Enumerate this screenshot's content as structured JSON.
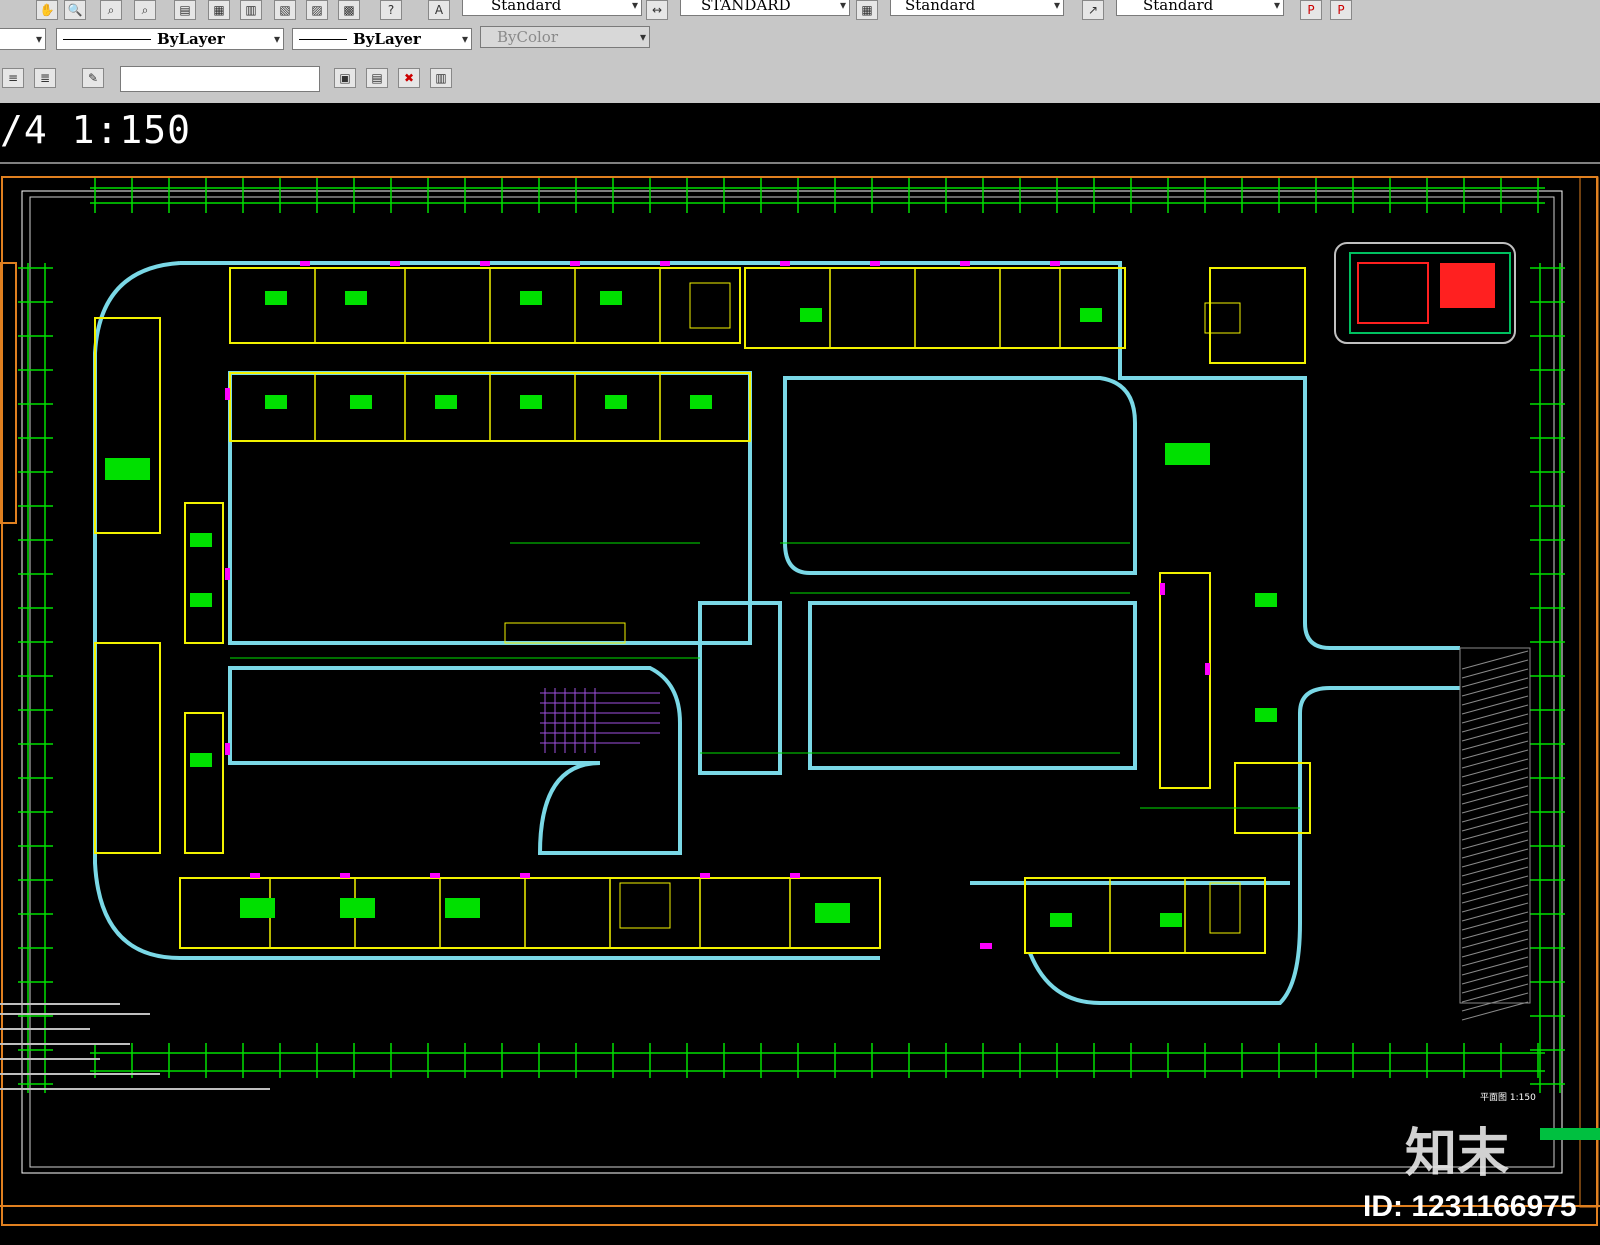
{
  "toolbar": {
    "text_style_label": "Standard",
    "dim_style_label": "STANDARD",
    "table_style_label": "Standard",
    "mleader_style_label": "Standard",
    "linetype_label": "ByLayer",
    "lineweight_label": "ByLayer",
    "plotstyle_label": "ByColor",
    "layer_input_value": ""
  },
  "drawing": {
    "scale_text": "/4 1:150",
    "title_block_label": "平面图 1:150"
  },
  "watermark": {
    "logo_text": "知末",
    "id_text": "ID: 1231166975"
  },
  "colors": {
    "background": "#000000",
    "wall_cyan": "#7ad8e6",
    "grid_green": "#00e000",
    "wall_yellow": "#f2f200",
    "door_magenta": "#ff00ff",
    "border_orange": "#e08020",
    "hatch_gray": "#8a8a8a",
    "stairs_purple": "#a050e0",
    "fill_green": "#00e000",
    "toolbar_gray": "#c7c7c7"
  }
}
